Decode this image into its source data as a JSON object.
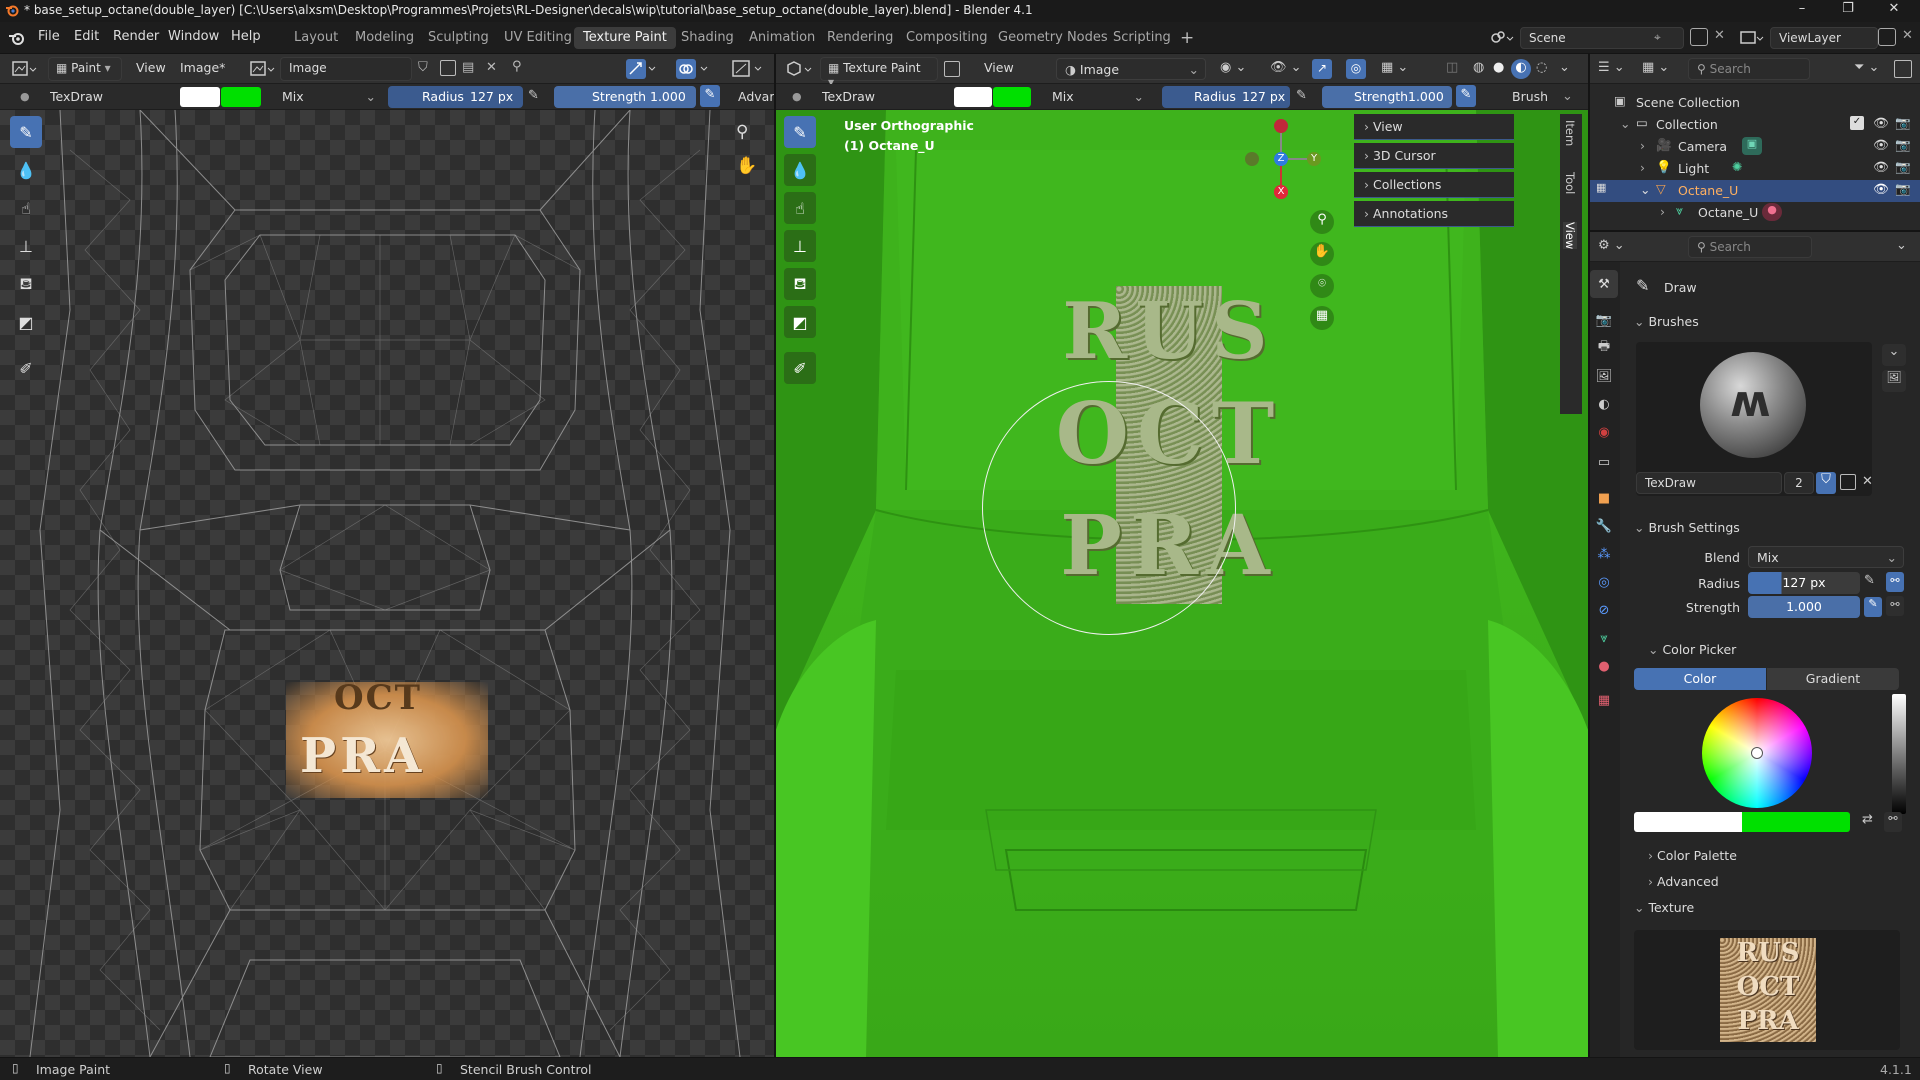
{
  "window": {
    "title": "* base_setup_octane(double_layer) [C:\\Users\\alxsm\\Desktop\\Programmes\\Projets\\RL-Designer\\decals\\wip\\tutorial\\base_setup_octane(double_layer).blend] - Blender 4.1",
    "controls": [
      "–",
      "❐",
      "✕"
    ]
  },
  "menu": [
    "File",
    "Edit",
    "Render",
    "Window",
    "Help"
  ],
  "workspaces": [
    "Layout",
    "Modeling",
    "Sculpting",
    "UV Editing",
    "Texture Paint",
    "Shading",
    "Animation",
    "Rendering",
    "Compositing",
    "Geometry Nodes",
    "Scripting"
  ],
  "active_workspace": "Texture Paint",
  "scene": {
    "name": "Scene",
    "view_layer": "ViewLayer"
  },
  "image_editor": {
    "mode": "Paint",
    "view": "View",
    "image_menu": "Image*",
    "image_name": "Image",
    "brush_name": "TexDraw",
    "blend": "Mix",
    "radius_label": "Radius",
    "radius_value": "127 px",
    "strength_label": "Strength",
    "strength_value": "1.000",
    "advanced": "Advar"
  },
  "viewport": {
    "mode": "Texture Paint",
    "view": "View",
    "image": "Image",
    "brush_name": "TexDraw",
    "blend": "Mix",
    "radius_label": "Radius",
    "radius_value": "127 px",
    "strength_label": "Strength",
    "strength_value": "1.000",
    "brush_menu": "Brush",
    "overlay_line1": "User Orthographic",
    "overlay_line2": "(1) Octane_U",
    "gizmo": {
      "z": "Z",
      "y": "Y",
      "x": "X"
    },
    "npanel_items": [
      "View",
      "3D Cursor",
      "Collections",
      "Annotations"
    ],
    "side_tabs": [
      "Item",
      "Tool",
      "View"
    ]
  },
  "decal_text": [
    "RUS",
    "OCT",
    "PRA"
  ],
  "outliner": {
    "search_placeholder": "Search",
    "rows": [
      {
        "label": "Scene Collection"
      },
      {
        "label": "Collection"
      },
      {
        "label": "Camera"
      },
      {
        "label": "Light"
      },
      {
        "label": "Octane_U"
      },
      {
        "label": "Octane_U"
      }
    ]
  },
  "properties": {
    "search_placeholder": "Search",
    "tool": "Draw",
    "brushes_header": "Brushes",
    "brush_name": "TexDraw",
    "brush_users": "2",
    "brush_settings_header": "Brush Settings",
    "blend_label": "Blend",
    "blend_value": "Mix",
    "radius_label": "Radius",
    "radius_value": "127 px",
    "strength_label": "Strength",
    "strength_value": "1.000",
    "color_picker_header": "Color Picker",
    "color_tab": "Color",
    "gradient_tab": "Gradient",
    "color_palette": "Color Palette",
    "advanced": "Advanced",
    "texture": "Texture"
  },
  "colors": {
    "accent": "#4772b3",
    "primary_color": "#ffffff",
    "secondary_color": "#00e000",
    "model_green": "#3cb018",
    "selected_row": "#334d80"
  },
  "status_bar": {
    "left": "Image Paint",
    "middle": "Rotate View",
    "right": "Stencil Brush Control",
    "version": "4.1.1"
  }
}
